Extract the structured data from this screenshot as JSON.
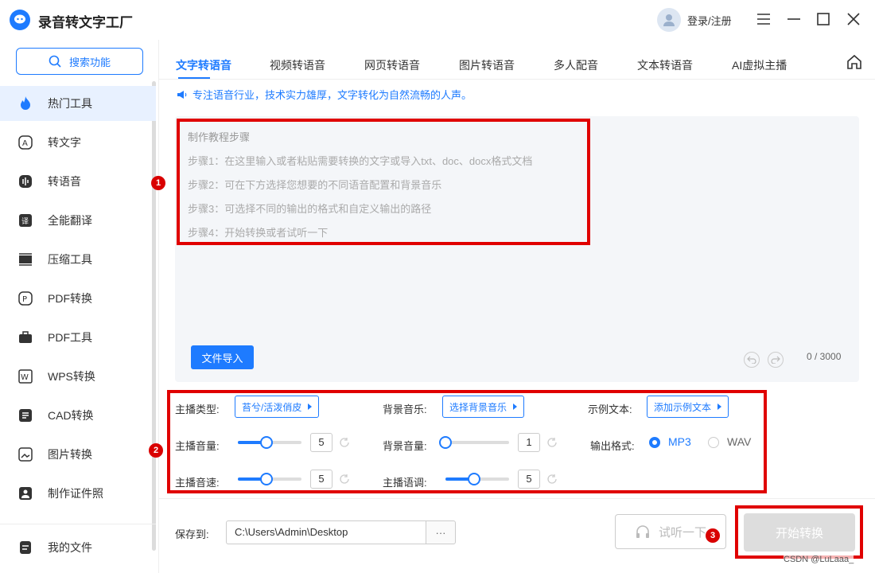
{
  "app": {
    "title": "录音转文字工厂",
    "login_label": "登录/注册"
  },
  "sidebar": {
    "search_label": "搜索功能",
    "items": [
      {
        "label": "热门工具",
        "icon": "flame-icon"
      },
      {
        "label": "转文字",
        "icon": "text-convert-icon"
      },
      {
        "label": "转语音",
        "icon": "voice-icon"
      },
      {
        "label": "全能翻译",
        "icon": "translate-icon"
      },
      {
        "label": "压缩工具",
        "icon": "compress-icon"
      },
      {
        "label": "PDF转换",
        "icon": "pdf-convert-icon"
      },
      {
        "label": "PDF工具",
        "icon": "briefcase-icon"
      },
      {
        "label": "WPS转换",
        "icon": "wps-icon"
      },
      {
        "label": "CAD转换",
        "icon": "cad-icon"
      },
      {
        "label": "图片转换",
        "icon": "image-icon"
      },
      {
        "label": "制作证件照",
        "icon": "id-photo-icon"
      }
    ],
    "my_files_label": "我的文件"
  },
  "tabs": [
    "文字转语音",
    "视频转语音",
    "网页转语音",
    "图片转语音",
    "多人配音",
    "文本转语音",
    "AI虚拟主播"
  ],
  "tip": "专注语音行业，技术实力雄厚，文字转化为自然流畅的人声。",
  "editor": {
    "lines": [
      "制作教程步骤",
      "步骤1：在这里输入或者粘贴需要转换的文字或导入txt、doc、docx格式文档",
      "步骤2：可在下方选择您想要的不同语音配置和背景音乐",
      "步骤3：可选择不同的输出的格式和自定义输出的路径",
      "步骤4：开始转换或者试听一下"
    ],
    "import_label": "文件导入",
    "counter": "0 / 3000"
  },
  "settings": {
    "anchor_type_label": "主播类型:",
    "anchor_type_value": "苔兮/活泼俏皮",
    "bg_music_label": "背景音乐:",
    "bg_music_value": "选择背景音乐",
    "sample_text_label": "示例文本:",
    "sample_text_value": "添加示例文本",
    "anchor_volume_label": "主播音量:",
    "anchor_volume_value": "5",
    "anchor_volume_level": 0.45,
    "bg_volume_label": "背景音量:",
    "bg_volume_value": "1",
    "bg_volume_level": 0.0,
    "output_format_label": "输出格式:",
    "format_options": [
      "MP3",
      "WAV"
    ],
    "format_selected": "MP3",
    "anchor_speed_label": "主播音速:",
    "anchor_speed_value": "5",
    "anchor_speed_level": 0.45,
    "anchor_pitch_label": "主播语调:",
    "anchor_pitch_value": "5",
    "anchor_pitch_level": 0.45
  },
  "bottom": {
    "save_to_label": "保存到:",
    "path": "C:\\Users\\Admin\\Desktop",
    "browse_label": "···",
    "listen_label": "试听一下",
    "start_label": "开始转换"
  },
  "markers": [
    "1",
    "2",
    "3"
  ],
  "watermark": "CSDN @LuLaaa_",
  "colors": {
    "accent": "#1e7bff",
    "highlight": "#e00000",
    "marker": "#d90000"
  }
}
